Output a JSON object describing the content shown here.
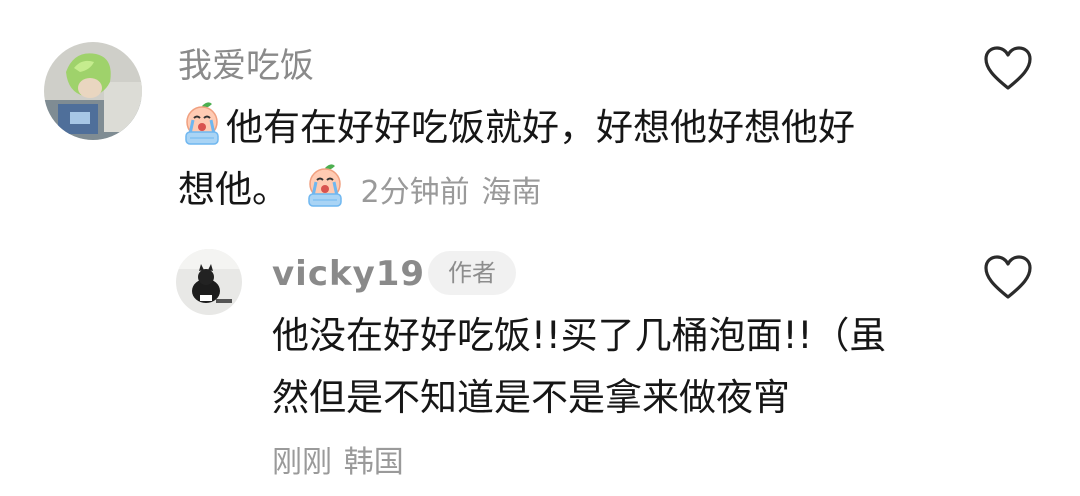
{
  "comments": [
    {
      "username": "我爱吃饭",
      "text_line1": "他有在好好吃饭就好，好想他好想他好",
      "text_line2": "想他。",
      "timestamp": "2分钟前",
      "location": "海南",
      "emoji_icon": "crying-peach-emoji-icon",
      "like_icon": "heart-outline-icon",
      "replies": [
        {
          "username": "vicky19",
          "badge": "作者",
          "text_line1": "他没在好好吃饭!!买了几桶泡面!!（虽",
          "text_line2": "然但是不知道是不是拿来做夜宵",
          "timestamp": "刚刚",
          "location": "韩国",
          "like_icon": "heart-outline-icon"
        }
      ]
    }
  ],
  "colors": {
    "text": "#161616",
    "meta": "#9a9a9a",
    "username": "#8a8a8a",
    "badge_bg": "#f1f1f1",
    "heart_stroke": "#2b2b2b"
  }
}
